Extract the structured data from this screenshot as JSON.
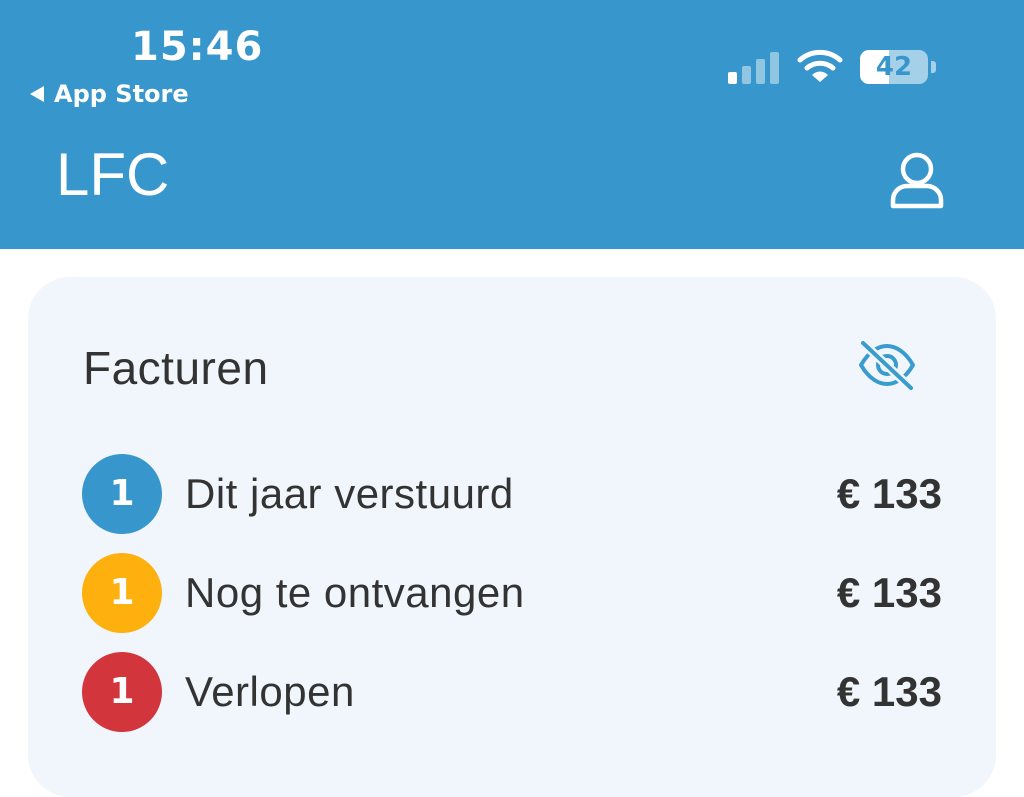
{
  "status_bar": {
    "time": "15:46",
    "back_label": "App Store",
    "battery_level": "42",
    "battery_fraction": 0.42
  },
  "header": {
    "title": "LFC",
    "profile_icon": "person-icon",
    "background_color": "#3797cd"
  },
  "card": {
    "title": "Facturen",
    "visibility_icon": "eye-slash-icon",
    "rows": [
      {
        "count": "1",
        "label": "Dit jaar verstuurd",
        "amount": "€ 133",
        "color": "#3797cd"
      },
      {
        "count": "1",
        "label": "Nog te ontvangen",
        "amount": "€ 133",
        "color": "#fdb00e"
      },
      {
        "count": "1",
        "label": "Verlopen",
        "amount": "€ 133",
        "color": "#d2353c"
      }
    ]
  }
}
